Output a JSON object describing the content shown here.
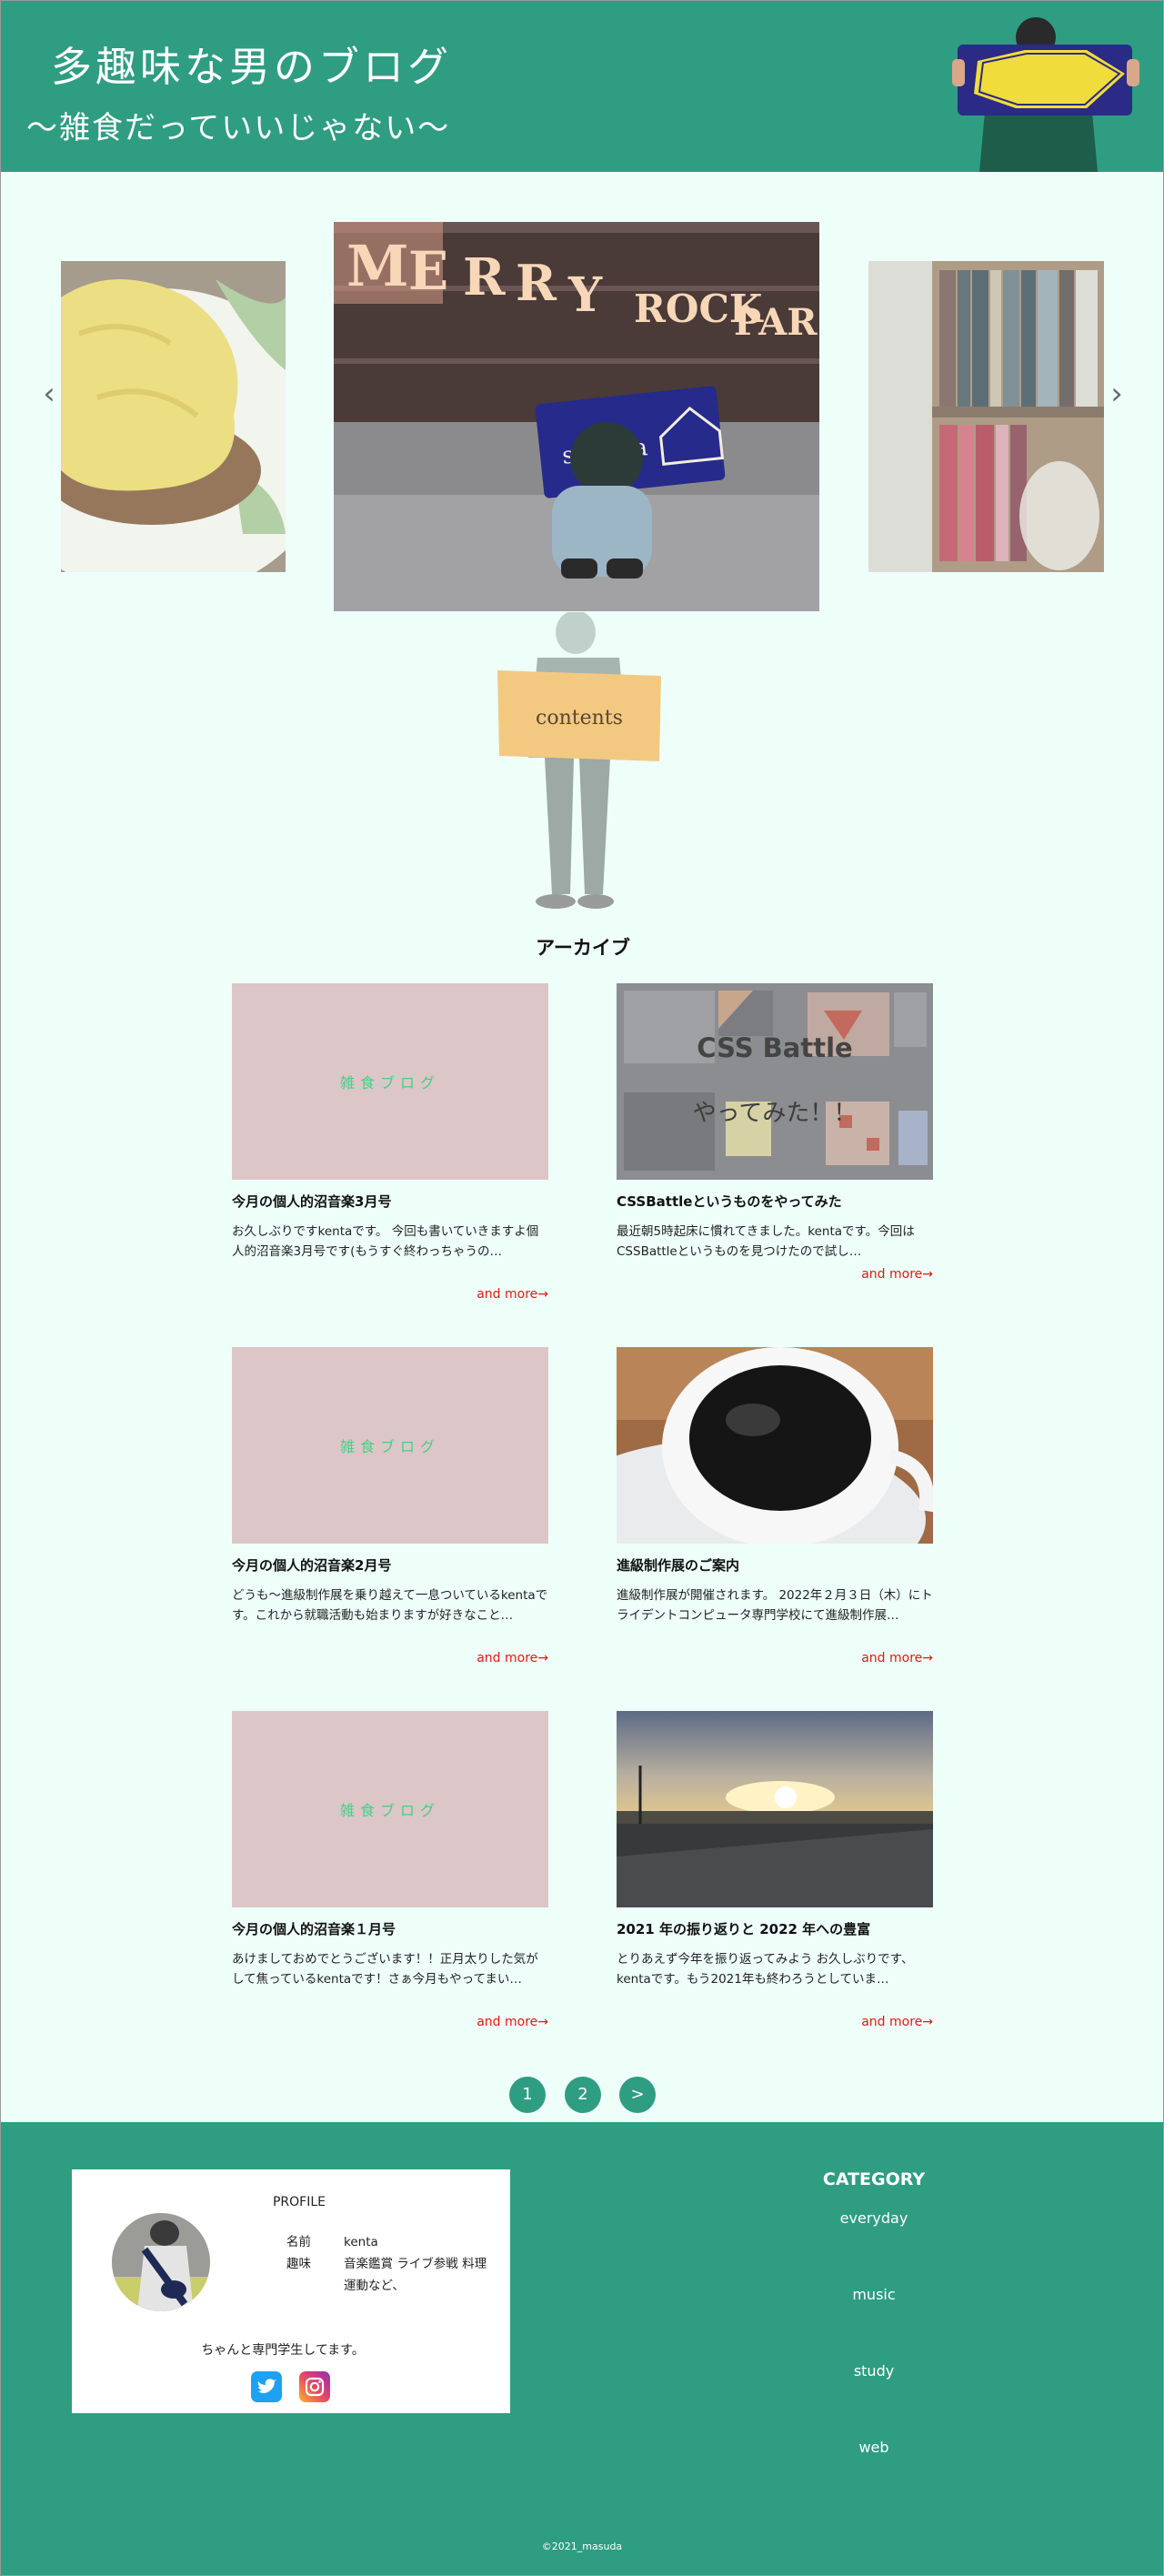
{
  "header": {
    "title": "多趣味な男のブログ",
    "subtitle": "〜雑食だっていいじゃない〜"
  },
  "slider": {
    "prev_icon": "chevron-left-icon",
    "next_icon": "chevron-right-icon",
    "prev_label": "‹",
    "next_label": "›",
    "center_photo_text": "MERRY ROCK PARADE",
    "center_towel_text": "sumika"
  },
  "contents": {
    "sign_text": "contents"
  },
  "archive": {
    "heading": "アーカイブ",
    "more_label": "and more→",
    "blog_thumb_text": "雑食ブログ",
    "css_thumb_line1": "CSS Battle",
    "css_thumb_line2": "やってみた！！",
    "posts": [
      {
        "title": "今月の個人的沼音楽3月号",
        "excerpt": "お久しぶりですkentaです。 今回も書いていきますよ個人的沼音楽3月号です(もうすぐ終わっちゃうの…"
      },
      {
        "title": "CSSBattleというものをやってみた",
        "excerpt": "最近朝5時起床に慣れてきました。kentaです。今回はCSSBattleというものを見つけたので試し…"
      },
      {
        "title": "今月の個人的沼音楽2月号",
        "excerpt": "どうも〜進級制作展を乗り越えて一息ついているkentaです。これから就職活動も始まりますが好きなこと…"
      },
      {
        "title": "進級制作展のご案内",
        "excerpt": "進級制作展が開催されます。 2022年２月３日（木）にトライデントコンピュータ専門学校にて進級制作展…"
      },
      {
        "title": "今月の個人的沼音楽１月号",
        "excerpt": "あけましておめでとうございます！！正月太りした気がして焦っているkentaです！さぁ今月もやってまい…"
      },
      {
        "title": "2021 年の振り返りと 2022 年への豊富",
        "excerpt": "とりあえず今年を振り返ってみよう お久しぶりです、kentaです。もう2021年も終わろうとしていま…"
      }
    ]
  },
  "pagination": {
    "pages": [
      "1",
      "2"
    ],
    "next": ">"
  },
  "footer": {
    "profile": {
      "heading": "PROFILE",
      "name_label": "名前",
      "name_value": "kenta",
      "hobby_label": "趣味",
      "hobby_value": "音楽鑑賞 ライブ参戦 料理 運動など、",
      "note": "ちゃんと専門学生してます。"
    },
    "social": {
      "twitter_icon": "twitter-icon",
      "instagram_icon": "instagram-icon"
    },
    "category": {
      "heading": "CATEGORY",
      "items": [
        "everyday",
        "music",
        "study",
        "web"
      ]
    },
    "copyright": "©2021_masuda"
  },
  "colors": {
    "brand_green": "#2f9d82",
    "page_background": "#eefffa",
    "more_link_red": "#e8160c",
    "blog_thumb_pink": "#dcc6c8",
    "blog_thumb_text_green": "#45d186"
  }
}
